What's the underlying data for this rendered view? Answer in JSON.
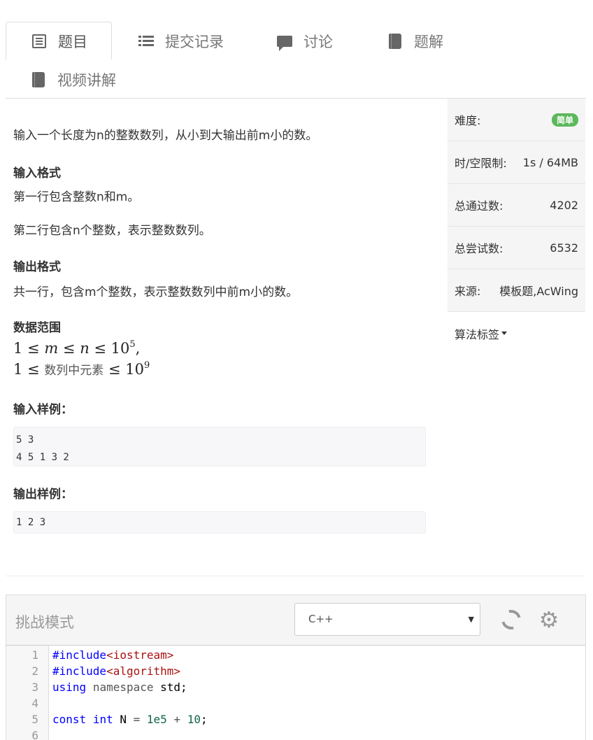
{
  "tabs": [
    {
      "label": "题目",
      "icon": "document-icon",
      "active": true
    },
    {
      "label": "提交记录",
      "icon": "list-icon",
      "active": false
    },
    {
      "label": "讨论",
      "icon": "comment-icon",
      "active": false
    },
    {
      "label": "题解",
      "icon": "book-icon",
      "active": false
    },
    {
      "label": "视频讲解",
      "icon": "book-icon",
      "active": false
    }
  ],
  "problem": {
    "description": "输入一个长度为n的整数数列，从小到大输出前m小的数。",
    "input_format": {
      "title": "输入格式",
      "lines": [
        "第一行包含整数n和m。",
        "第二行包含n个整数，表示整数数列。"
      ]
    },
    "output_format": {
      "title": "输出格式",
      "lines": [
        "共一行，包含m个整数，表示整数数列中前m小的数。"
      ]
    },
    "data_range": {
      "title": "数据范围",
      "line1": {
        "lhs": "1 ≤ ",
        "m": "m",
        "mid": " ≤ ",
        "n": "n",
        "rhs": " ≤ 10",
        "exp": "5",
        "tail": ","
      },
      "line2": {
        "lhs": "1 ≤ ",
        "cn": "数列中元素",
        "rhs": " ≤ 10",
        "exp": "9"
      }
    },
    "sample_input": {
      "title": "输入样例：",
      "text": "5 3\n4 5 1 3 2"
    },
    "sample_output": {
      "title": "输出样例：",
      "text": "1 2 3"
    }
  },
  "sidebar": {
    "difficulty": {
      "label": "难度:",
      "value": "简单",
      "color": "#5cb85c"
    },
    "limits": {
      "label": "时/空限制:",
      "value": "1s / 64MB"
    },
    "total_passed": {
      "label": "总通过数:",
      "value": "4202"
    },
    "total_attempts": {
      "label": "总尝试数:",
      "value": "6532"
    },
    "source": {
      "label": "来源:",
      "value": "模板题,AcWing"
    },
    "tags": {
      "label": "算法标签"
    }
  },
  "editor": {
    "mode_label": "挑战模式",
    "language": "C++",
    "lines": [
      {
        "n": "1",
        "segments": [
          [
            "kw2",
            "#include"
          ],
          [
            "str",
            "<iostream>"
          ]
        ]
      },
      {
        "n": "2",
        "segments": [
          [
            "kw2",
            "#include"
          ],
          [
            "str",
            "<algorithm>"
          ]
        ]
      },
      {
        "n": "3",
        "segments": [
          [
            "kw2",
            "using"
          ],
          [
            "",
            " "
          ],
          [
            "op",
            "namespace"
          ],
          [
            "",
            " std;"
          ]
        ]
      },
      {
        "n": "4",
        "segments": []
      },
      {
        "n": "5",
        "segments": [
          [
            "kw2",
            "const"
          ],
          [
            "",
            " "
          ],
          [
            "kw2",
            "int"
          ],
          [
            "",
            " N "
          ],
          [
            "op",
            "="
          ],
          [
            "",
            " "
          ],
          [
            "num",
            "1e5"
          ],
          [
            "",
            " "
          ],
          [
            "op",
            "+"
          ],
          [
            "",
            " "
          ],
          [
            "num",
            "10"
          ],
          [
            "",
            ";"
          ]
        ]
      },
      {
        "n": "6",
        "segments": []
      }
    ]
  }
}
